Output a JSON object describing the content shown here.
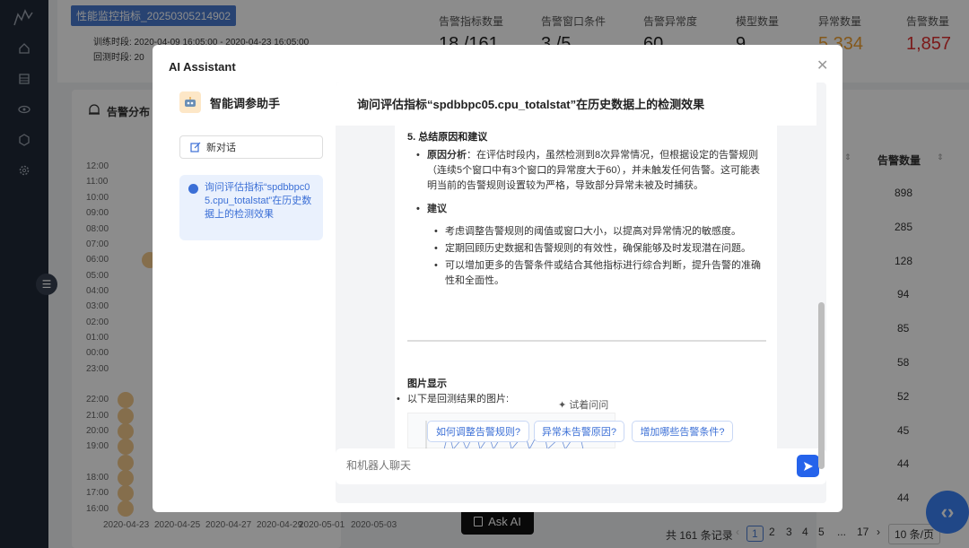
{
  "header": {
    "task_name": "性能监控指标_20250305214902",
    "train_period": "训练时段: 2020-04-09 16:05:00 - 2020-04-23 16:05:00",
    "backtest_period_label": "回测时段: 20",
    "stats": [
      {
        "label": "告警指标数量",
        "value": "18 /161"
      },
      {
        "label": "告警窗口条件",
        "value": "3 /5"
      },
      {
        "label": "告警异常度",
        "value": "60"
      },
      {
        "label": "模型数量",
        "value": "9"
      },
      {
        "label": "异常数量",
        "value": "5,334"
      },
      {
        "label": "告警数量",
        "value": "1,857"
      }
    ]
  },
  "left_panel": {
    "title": "告警分布",
    "y_ticks": [
      "12:00",
      "11:00",
      "10:00",
      "09:00",
      "08:00",
      "07:00",
      "06:00",
      "05:00",
      "04:00",
      "03:00",
      "02:00",
      "01:00",
      "00:00",
      "23:00",
      "22:00",
      "21:00",
      "20:00",
      "19:00",
      "18:00",
      "17:00",
      "16:00"
    ],
    "x_ticks": [
      "2020-04-23",
      "2020-04-25",
      "2020-04-27",
      "2020-04-29",
      "2020-05-01",
      "2020-05-03"
    ]
  },
  "right_table": {
    "column": "告警数量",
    "values": [
      "898",
      "285",
      "128",
      "94",
      "85",
      "58",
      "52",
      "45",
      "44",
      "44"
    ]
  },
  "pagination": {
    "total": "共 161 条记录",
    "pages": [
      "1",
      "2",
      "3",
      "4",
      "5",
      "17"
    ],
    "ellipsis": "...",
    "page_size": "10 条/页"
  },
  "ask_ai_label": "Ask AI",
  "modal": {
    "title": "AI Assistant",
    "assistant_name": "智能调参助手",
    "new_chat_label": "新对话",
    "history_item": "询问评估指标“spdbbpc05.cpu_totalstat”在历史数据上的检测效果",
    "question": "询问评估指标“spdbbpc05.cpu_totalstat”在历史数据上的检测效果",
    "section5_title": "5. 总结原因和建议",
    "reason_label": "原因分析",
    "reason_text": "：在评估时段内，虽然检测到8次异常情况，但根据设定的告警规则（连续5个窗口中有3个窗口的异常度大于60），并未触发任何告警。这可能表明当前的告警规则设置较为严格，导致部分异常未被及时捕获。",
    "advice_label": "建议",
    "advice_items": [
      "考虑调整告警规则的阈值或窗口大小，以提高对异常情况的敏感度。",
      "定期回顾历史数据和告警规则的有效性，确保能够及时发现潜在问题。",
      "可以增加更多的告警条件或结合其他指标进行综合判断，提升告警的准确性和全面性。"
    ],
    "image_section_title": "图片显示",
    "image_intro": "以下是回测结果的图片:",
    "try_ask_label": "试着问问",
    "suggestions": [
      "如何调整告警规则?",
      "异常未告警原因?",
      "增加哪些告警条件?"
    ],
    "input_placeholder": "和机器人聊天"
  }
}
